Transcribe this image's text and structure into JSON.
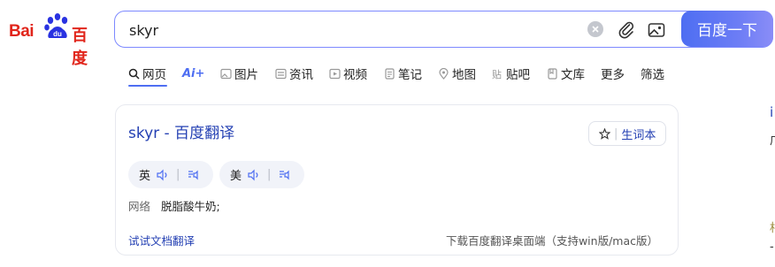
{
  "logo": {
    "text_left": "Bai",
    "text_paw": "du",
    "text_right": "百度"
  },
  "search": {
    "value": "skyr",
    "submit_label": "百度一下"
  },
  "tabs": [
    {
      "label": "网页",
      "icon": "search-icon",
      "active": true
    },
    {
      "label": "Ai+",
      "icon": "ai-icon",
      "active": false
    },
    {
      "label": "图片",
      "icon": "image-icon",
      "active": false
    },
    {
      "label": "资讯",
      "icon": "news-icon",
      "active": false
    },
    {
      "label": "视频",
      "icon": "video-icon",
      "active": false
    },
    {
      "label": "笔记",
      "icon": "note-icon",
      "active": false
    },
    {
      "label": "地图",
      "icon": "map-icon",
      "active": false
    },
    {
      "label": "贴吧",
      "icon": "tieba-icon",
      "active": false
    },
    {
      "label": "文库",
      "icon": "wenku-icon",
      "active": false
    },
    {
      "label": "更多",
      "icon": "",
      "active": false
    },
    {
      "label": "筛选",
      "icon": "",
      "active": false
    }
  ],
  "card": {
    "title": "skyr - 百度翻译",
    "vocab_label": "生词本",
    "pron_en": "英",
    "pron_us": "美",
    "def_label": "网络",
    "def_value": "脱脂酸牛奶;",
    "try_link": "试试文档翻译",
    "download_link": "下载百度翻译桌面端（支持win版/mac版）"
  },
  "right_edge": [
    "i",
    "广",
    "相",
    "-"
  ],
  "colors": {
    "brand_red": "#e1251b",
    "accent_blue": "#4e6ef2",
    "link_blue": "#2440b3"
  }
}
